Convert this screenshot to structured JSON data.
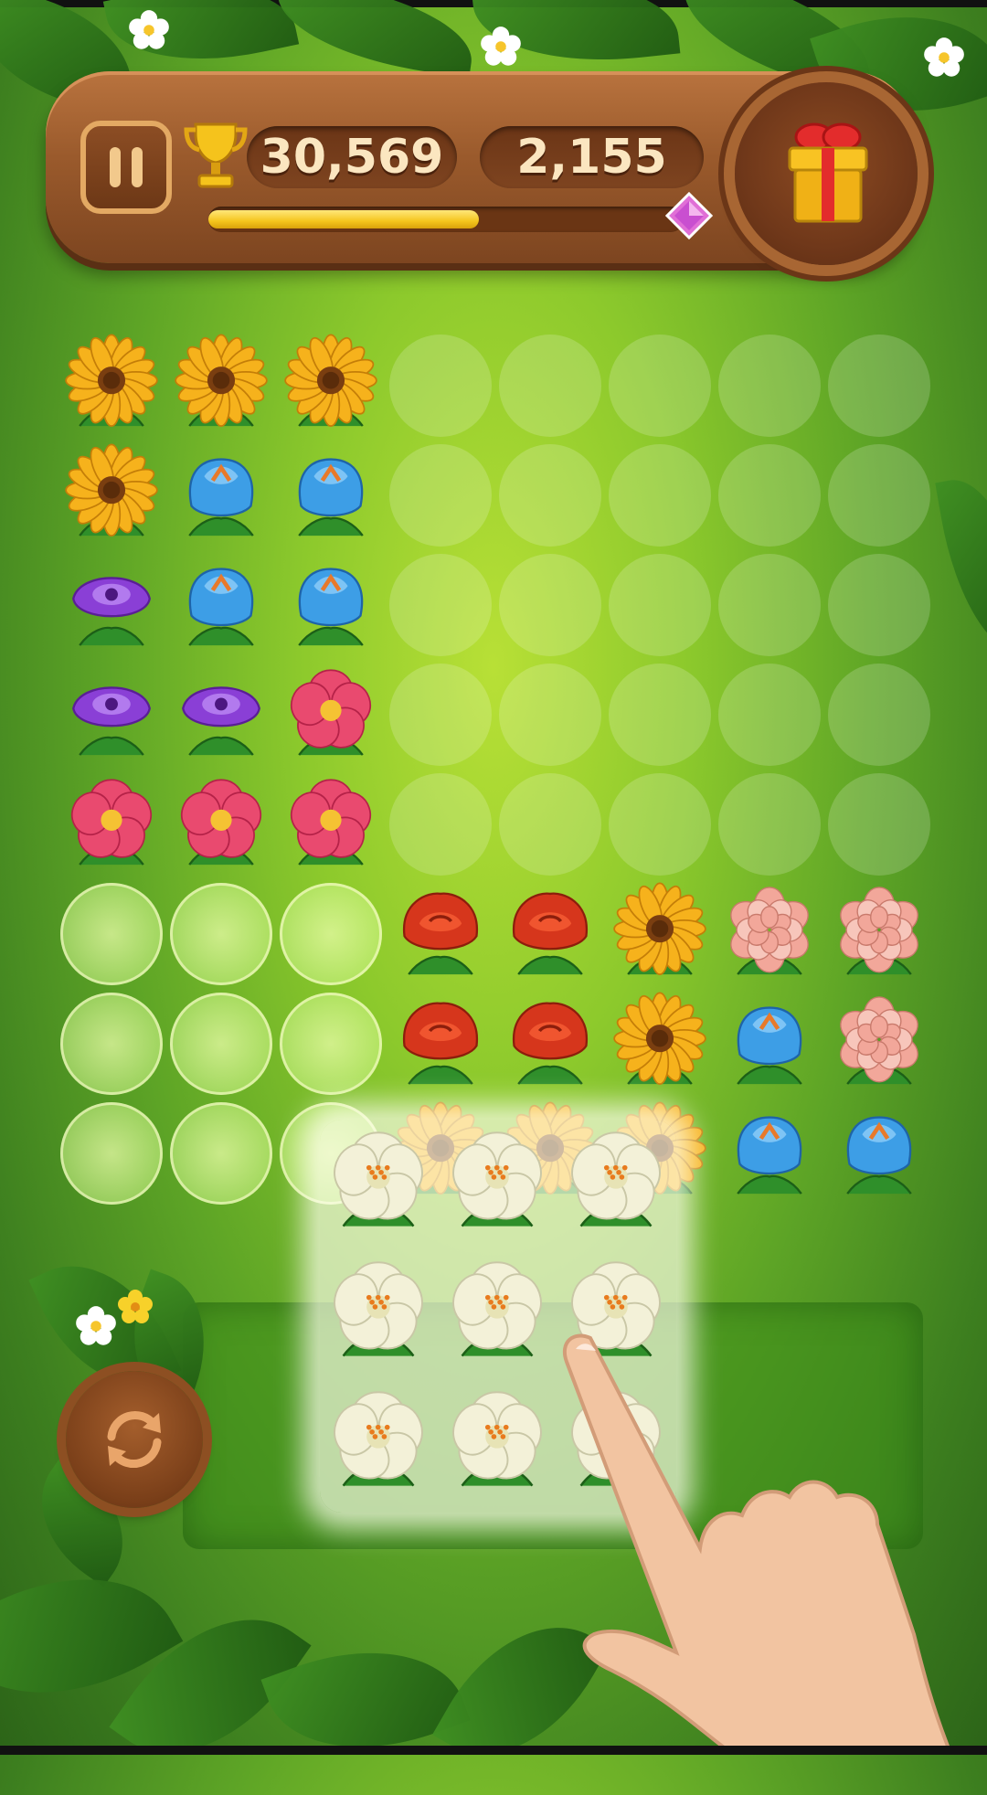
{
  "header": {
    "score": "30,569",
    "moves": "2,155",
    "progress_fraction": 0.57,
    "pause_icon": "pause-icon",
    "trophy_icon": "trophy-icon",
    "gem_icon": "pink-gem-icon",
    "gift_icon": "gift-box-icon"
  },
  "colors": {
    "wood": "#9a5a2c",
    "pill_text": "#fbe6c0",
    "progress": "#f5c51c",
    "sunflower": "#f6b21c",
    "bluerose": "#3d9ee6",
    "purple": "#8a3fd6",
    "pinkrose": "#e94a6f",
    "redrose": "#d6361c",
    "peony": "#f2a79a",
    "whiterose": "#f3f1d8"
  },
  "grid": {
    "cols": 8,
    "rows": 8,
    "cells": [
      [
        "sunflower",
        "sunflower",
        "sunflower",
        "empty",
        "empty",
        "empty",
        "empty",
        "empty"
      ],
      [
        "sunflower",
        "bluerose",
        "bluerose",
        "empty",
        "empty",
        "empty",
        "empty",
        "empty"
      ],
      [
        "purple",
        "bluerose",
        "bluerose",
        "empty",
        "empty",
        "empty",
        "empty",
        "empty"
      ],
      [
        "purple",
        "purple",
        "pinkrose",
        "empty",
        "empty",
        "empty",
        "empty",
        "empty"
      ],
      [
        "pinkrose",
        "pinkrose",
        "pinkrose",
        "empty",
        "empty",
        "empty",
        "empty",
        "empty"
      ],
      [
        "glow",
        "glow",
        "glow",
        "redrose",
        "redrose",
        "sunflower",
        "peony",
        "peony"
      ],
      [
        "glow",
        "glow",
        "glow",
        "redrose",
        "redrose",
        "sunflower",
        "bluerose",
        "peony"
      ],
      [
        "glow",
        "glow",
        "glow",
        "sunflower",
        "sunflower",
        "sunflower",
        "bluerose",
        "bluerose"
      ]
    ]
  },
  "piece": {
    "flower": "whiterose",
    "rows": 3,
    "cols": 3
  },
  "controls": {
    "refresh_icon": "refresh-icon",
    "hand_icon": "tutorial-hand-pointer"
  }
}
